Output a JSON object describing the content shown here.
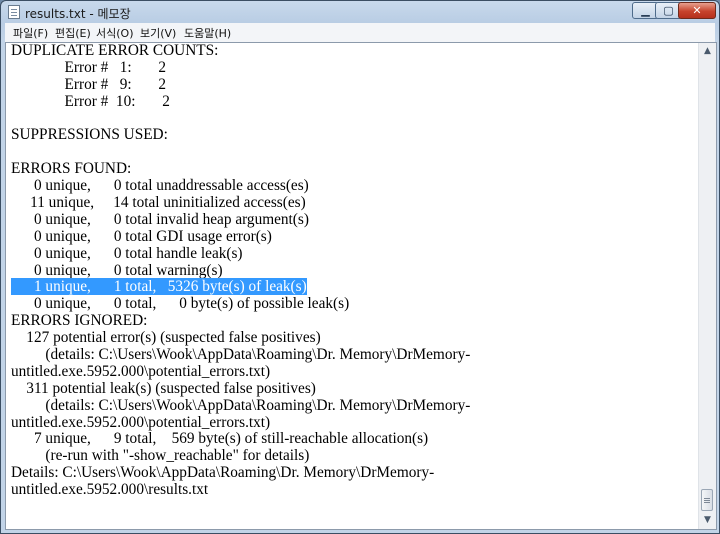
{
  "window": {
    "title": "results.txt - 메모장",
    "buttons": {
      "minimize": "▁",
      "maximize": "▢",
      "close": "✕"
    }
  },
  "menu": [
    {
      "label": "파일(F)"
    },
    {
      "label": "편집(E)"
    },
    {
      "label": "서식(O)"
    },
    {
      "label": "보기(V)"
    },
    {
      "label": "도움말(H)"
    }
  ],
  "editor": {
    "lines": [
      "DUPLICATE ERROR COUNTS:",
      "              Error #   1:       2",
      "              Error #   9:       2",
      "              Error #  10:       2",
      "",
      "SUPPRESSIONS USED:",
      "",
      "ERRORS FOUND:",
      "      0 unique,      0 total unaddressable access(es)",
      "     11 unique,     14 total uninitialized access(es)",
      "      0 unique,      0 total invalid heap argument(s)",
      "      0 unique,      0 total GDI usage error(s)",
      "      0 unique,      0 total handle leak(s)",
      "      0 unique,      0 total warning(s)",
      "      1 unique,      1 total,   5326 byte(s) of leak(s)",
      "      0 unique,      0 total,      0 byte(s) of possible leak(s)",
      "ERRORS IGNORED:",
      "    127 potential error(s) (suspected false positives)",
      "         (details: C:\\Users\\Wook\\AppData\\Roaming\\Dr. Memory\\DrMemory-",
      "untitled.exe.5952.000\\potential_errors.txt)",
      "    311 potential leak(s) (suspected false positives)",
      "         (details: C:\\Users\\Wook\\AppData\\Roaming\\Dr. Memory\\DrMemory-",
      "untitled.exe.5952.000\\potential_errors.txt)",
      "      7 unique,      9 total,    569 byte(s) of still-reachable allocation(s)",
      "         (re-run with \"-show_reachable\" for details)",
      "Details: C:\\Users\\Wook\\AppData\\Roaming\\Dr. Memory\\DrMemory-",
      "untitled.exe.5952.000\\results.txt"
    ],
    "selected_line_index": 14
  },
  "scrollbar": {
    "up_arrow": "▲",
    "down_arrow": "▼"
  }
}
